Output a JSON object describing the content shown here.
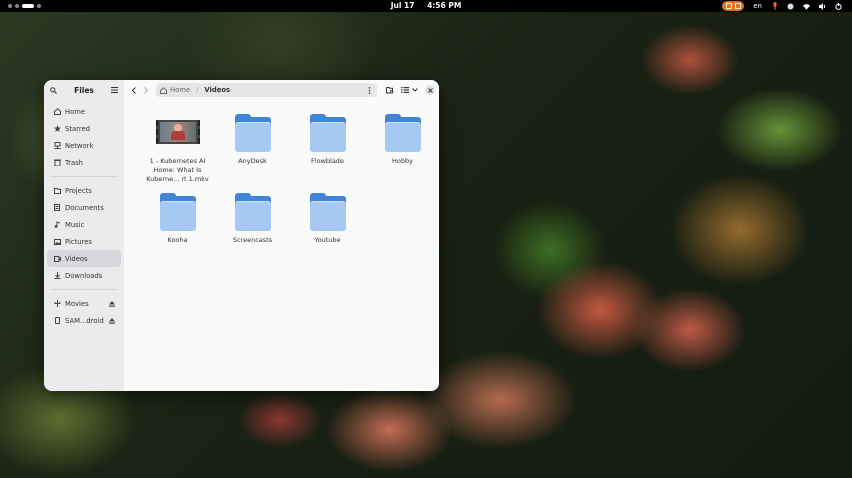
{
  "topbar": {
    "date": "Jul 17",
    "time": "4:56 PM",
    "keyboard_layout": "en",
    "accent_color": "#e8701c"
  },
  "window": {
    "app_title": "Files",
    "sidebar": {
      "places": [
        {
          "label": "Home",
          "icon": "home-icon"
        },
        {
          "label": "Starred",
          "icon": "star-icon"
        },
        {
          "label": "Network",
          "icon": "network-icon"
        },
        {
          "label": "Trash",
          "icon": "trash-icon"
        }
      ],
      "bookmarks": [
        {
          "label": "Projects",
          "icon": "folder-icon"
        },
        {
          "label": "Documents",
          "icon": "document-icon"
        },
        {
          "label": "Music",
          "icon": "music-icon"
        },
        {
          "label": "Pictures",
          "icon": "picture-icon"
        },
        {
          "label": "Videos",
          "icon": "video-icon",
          "selected": true
        },
        {
          "label": "Downloads",
          "icon": "download-icon"
        }
      ],
      "devices": [
        {
          "label": "Movies",
          "icon": "usb-icon"
        },
        {
          "label": "SAM...droid",
          "icon": "phone-icon"
        }
      ]
    },
    "path": {
      "root": "Home",
      "current": "Videos"
    },
    "items": [
      {
        "name": "1 - Kubernetes AI Home: What Is Kuberne... rt 1.mkv",
        "type": "video"
      },
      {
        "name": "AnyDesk",
        "type": "folder"
      },
      {
        "name": "Flowblade",
        "type": "folder"
      },
      {
        "name": "Hobby",
        "type": "folder"
      },
      {
        "name": "Kooha",
        "type": "folder"
      },
      {
        "name": "Screencasts",
        "type": "folder"
      },
      {
        "name": "Youtube",
        "type": "folder"
      }
    ],
    "folder_color": "#3f87d6"
  }
}
